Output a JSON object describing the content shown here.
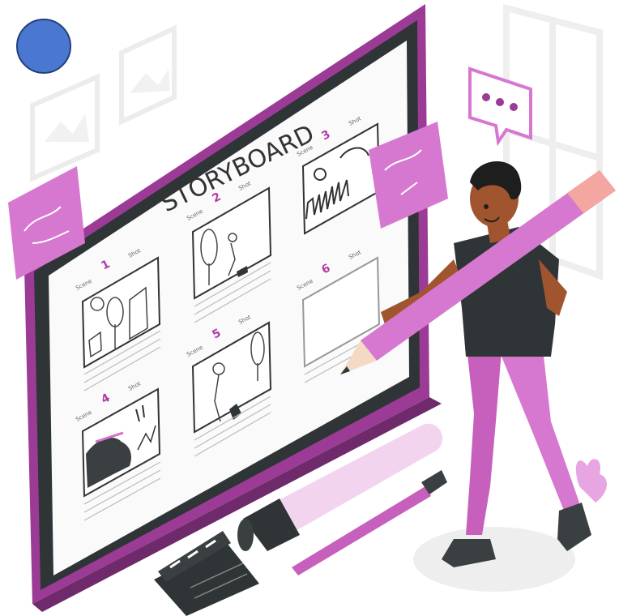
{
  "board": {
    "title": "STORYBOARD",
    "scene_label": "Scene",
    "shot_label": "Shot"
  },
  "panels": [
    {
      "number": "1"
    },
    {
      "number": "2"
    },
    {
      "number": "3"
    },
    {
      "number": "4"
    },
    {
      "number": "5"
    },
    {
      "number": "6"
    }
  ],
  "colors": {
    "brand_purple": "#9c3b95",
    "accent_pink": "#d46fcc",
    "board_dark": "#2f3537",
    "status_dot": "#4a77cf"
  }
}
